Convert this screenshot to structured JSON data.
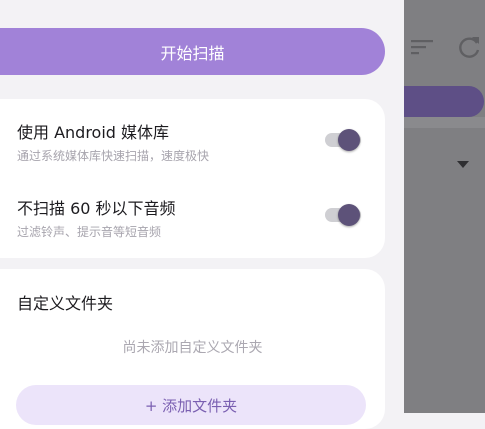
{
  "drawer": {
    "scan_button_label": "开始扫描",
    "settings": [
      {
        "title": "使用 Android 媒体库",
        "subtitle": "通过系统媒体库快速扫描，速度极快",
        "enabled": true
      },
      {
        "title": "不扫描 60 秒以下音频",
        "subtitle": "过滤铃声、提示音等短音频",
        "enabled": true
      }
    ],
    "folders": {
      "title": "自定义文件夹",
      "empty_text": "尚未添加自定义文件夹",
      "add_button_label": "+ 添加文件夹"
    }
  },
  "background": {
    "icons": [
      "sort-icon",
      "refresh-icon",
      "dropdown-icon"
    ]
  },
  "colors": {
    "accent": "#a182d8",
    "toggle_thumb": "#5d5279",
    "add_button_bg": "#ece4fa",
    "scrim": "#7f7f82"
  }
}
